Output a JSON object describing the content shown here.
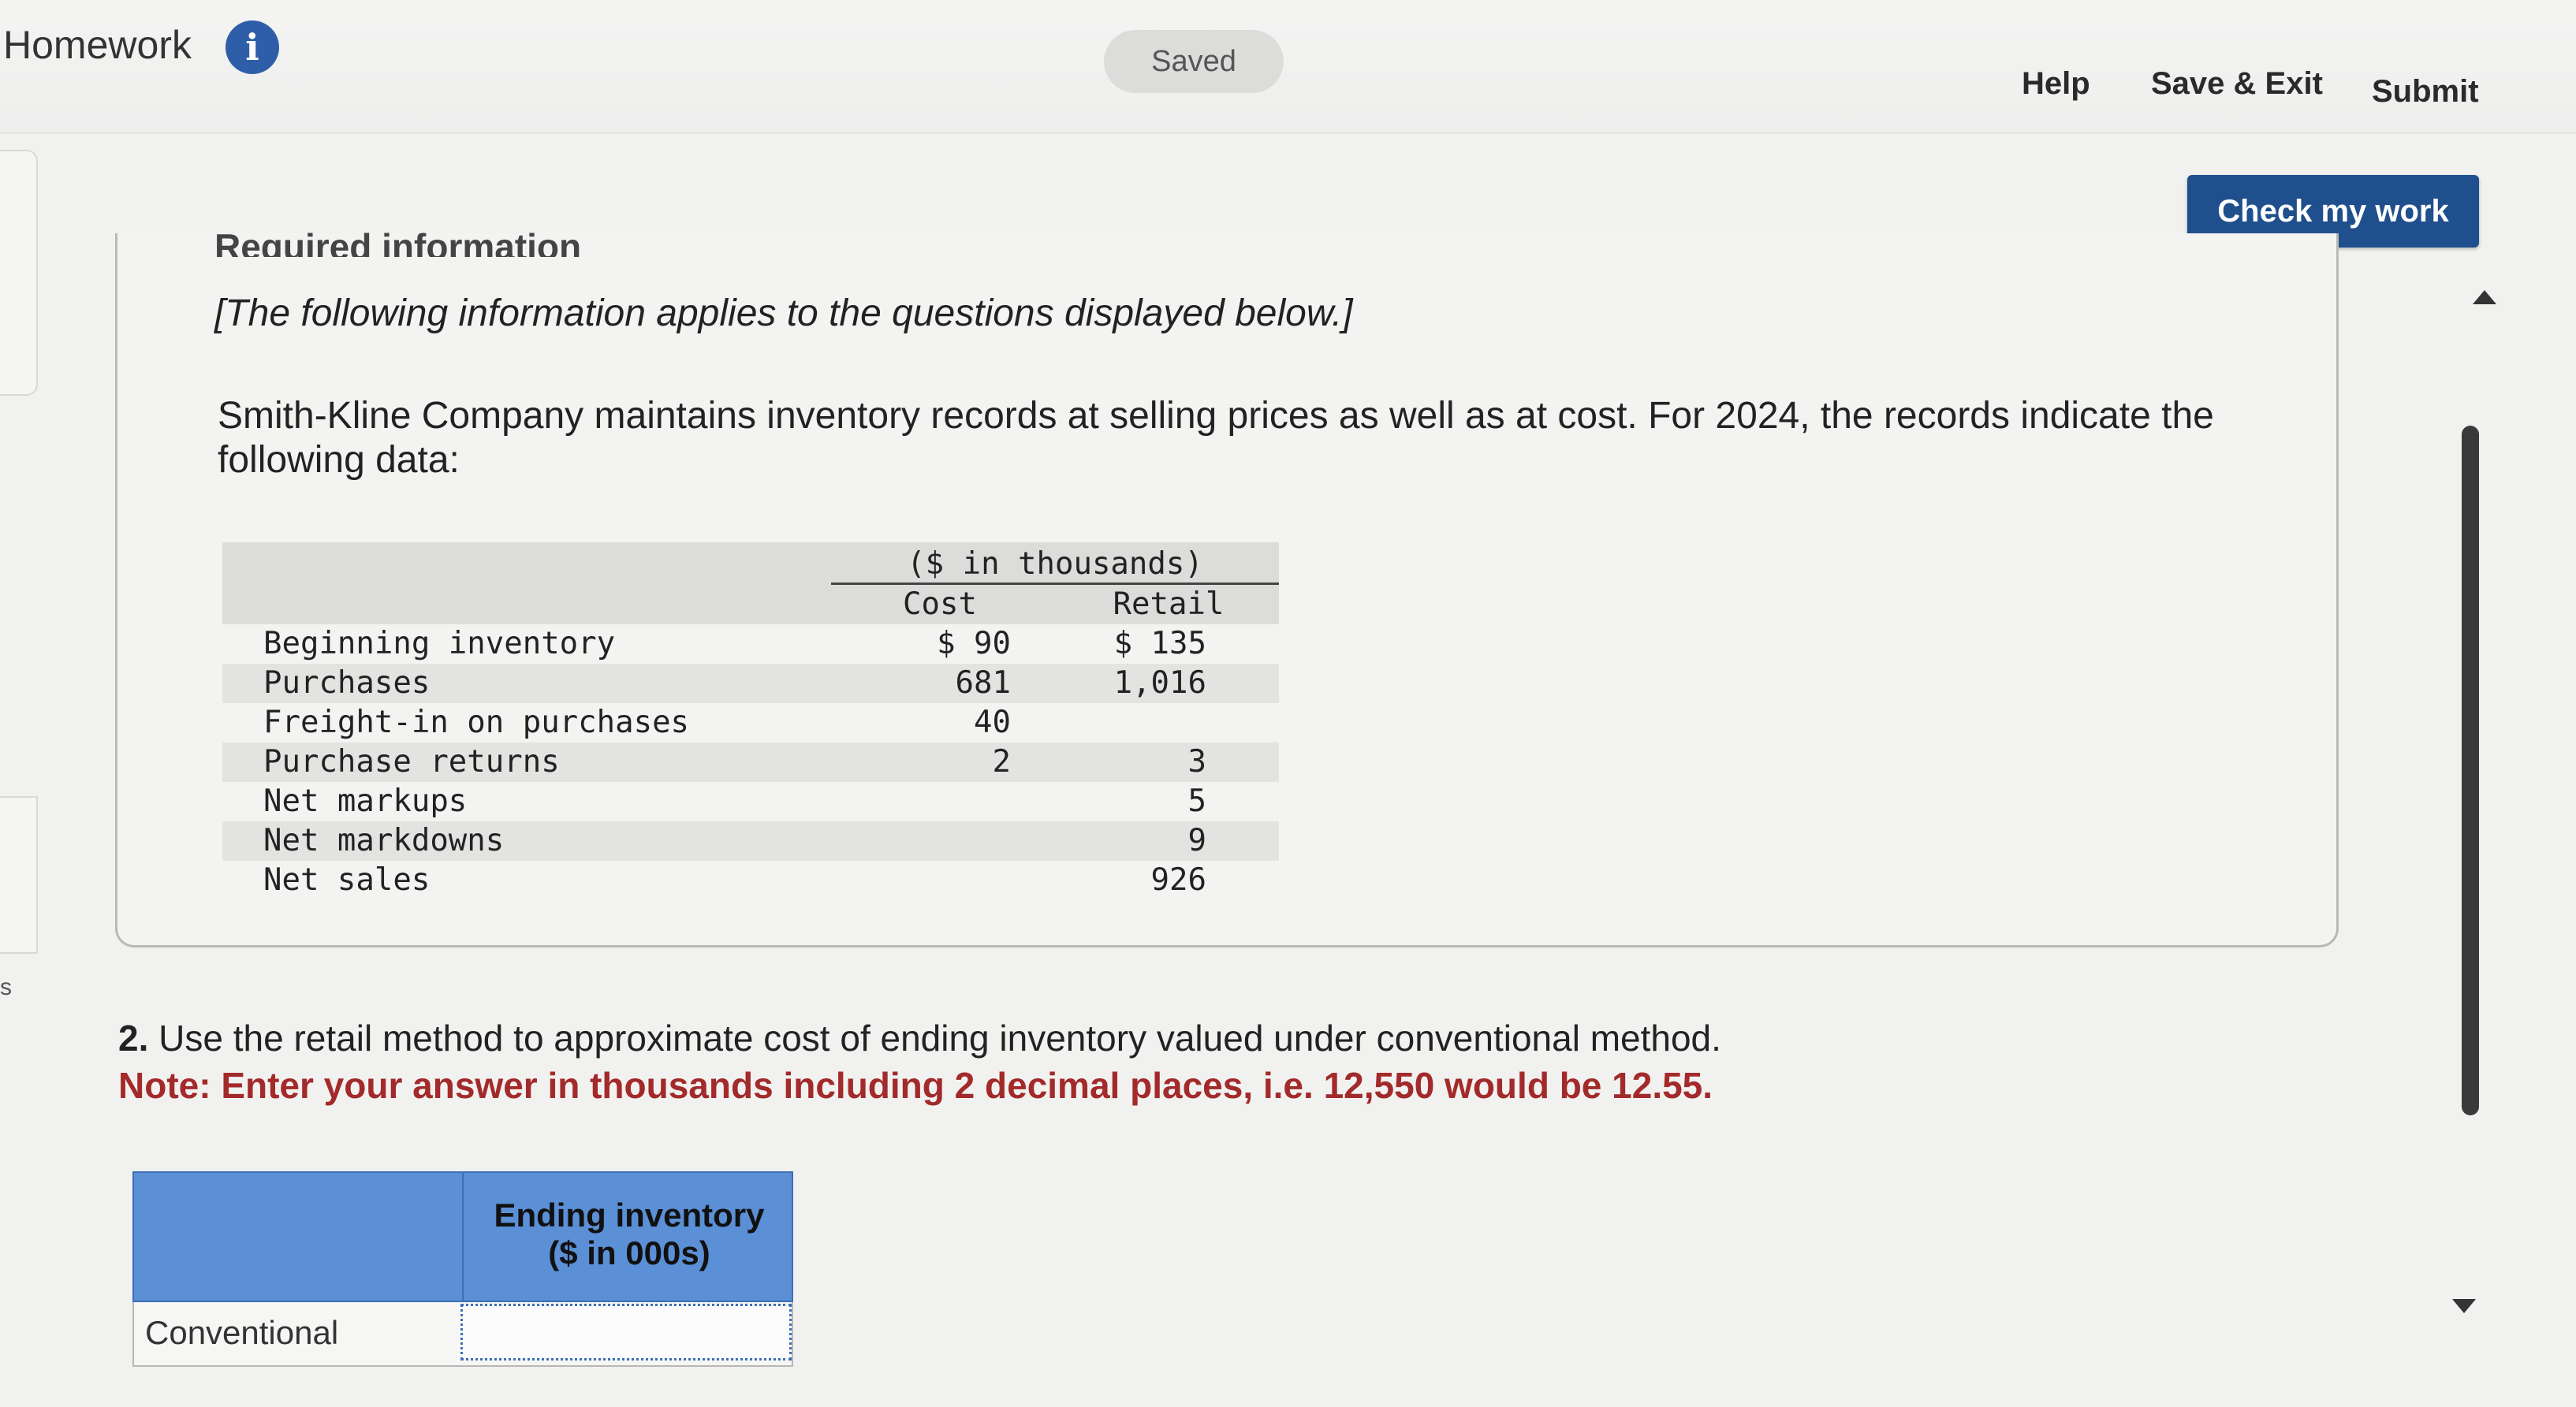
{
  "header": {
    "title": "Homework",
    "info_icon": "info-icon",
    "saved_label": "Saved",
    "help_label": "Help",
    "save_exit_label": "Save & Exit",
    "submit_label": "Submit"
  },
  "toolbar": {
    "check_label": "Check my work"
  },
  "left_rail": {
    "letter": "s"
  },
  "panel": {
    "heading": "Required information",
    "intro_note": "[The following information applies to the questions displayed below.]",
    "description": "Smith-Kline Company maintains inventory records at selling prices as well as at cost. For 2024, the records indicate the following data:",
    "table": {
      "group_header": "($ in thousands)",
      "col_cost": "Cost",
      "col_retail": "Retail",
      "rows": [
        {
          "label": "Beginning inventory",
          "cost": "$ 90",
          "retail": "$ 135"
        },
        {
          "label": "Purchases",
          "cost": "681",
          "retail": "1,016"
        },
        {
          "label": "Freight-in on purchases",
          "cost": "40",
          "retail": ""
        },
        {
          "label": "Purchase returns",
          "cost": "2",
          "retail": "3"
        },
        {
          "label": "Net markups",
          "cost": "",
          "retail": "5"
        },
        {
          "label": "Net markdowns",
          "cost": "",
          "retail": "9"
        },
        {
          "label": "Net sales",
          "cost": "",
          "retail": "926"
        }
      ]
    }
  },
  "question": {
    "number": "2.",
    "text": "Use the retail method to approximate cost of ending inventory valued under conventional method.",
    "note": "Note: Enter your answer in thousands including 2 decimal places, i.e. 12,550 would be 12.55."
  },
  "answer_table": {
    "column_title_line1": "Ending inventory",
    "column_title_line2": "($ in 000s)",
    "row_label": "Conventional",
    "value": ""
  }
}
